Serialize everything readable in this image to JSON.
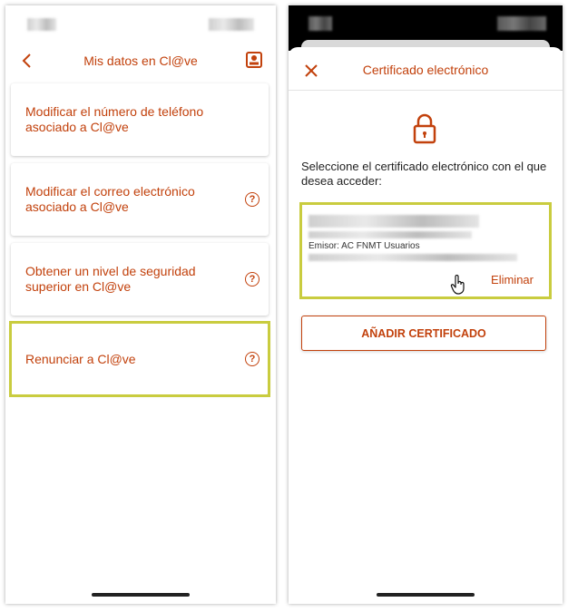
{
  "left_screen": {
    "header": {
      "title": "Mis datos en Cl@ve",
      "back_icon": "chevron-left-icon",
      "profile_icon": "id-card-icon"
    },
    "menu_items": [
      {
        "label": "Modificar el número de teléfono asociado a Cl@ve",
        "has_help": false
      },
      {
        "label": "Modificar el correo electrónico asociado a Cl@ve",
        "has_help": true
      },
      {
        "label": "Obtener un nivel de seguridad superior en Cl@ve",
        "has_help": true
      },
      {
        "label": "Renunciar a Cl@ve",
        "has_help": true,
        "highlighted": true
      }
    ]
  },
  "right_screen": {
    "header": {
      "title": "Certificado electrónico",
      "close_icon": "close-icon"
    },
    "lock_icon": "lock-icon",
    "instructions": "Seleccione el certificado electrónico con el que desea acceder:",
    "certificate": {
      "issuer": "Emisor: AC FNMT Usuarios",
      "delete_label": "Eliminar"
    },
    "add_button_label": "AÑADIR CERTIFICADO"
  },
  "colors": {
    "accent": "#c2410c",
    "highlight": "#c9cc3f"
  }
}
